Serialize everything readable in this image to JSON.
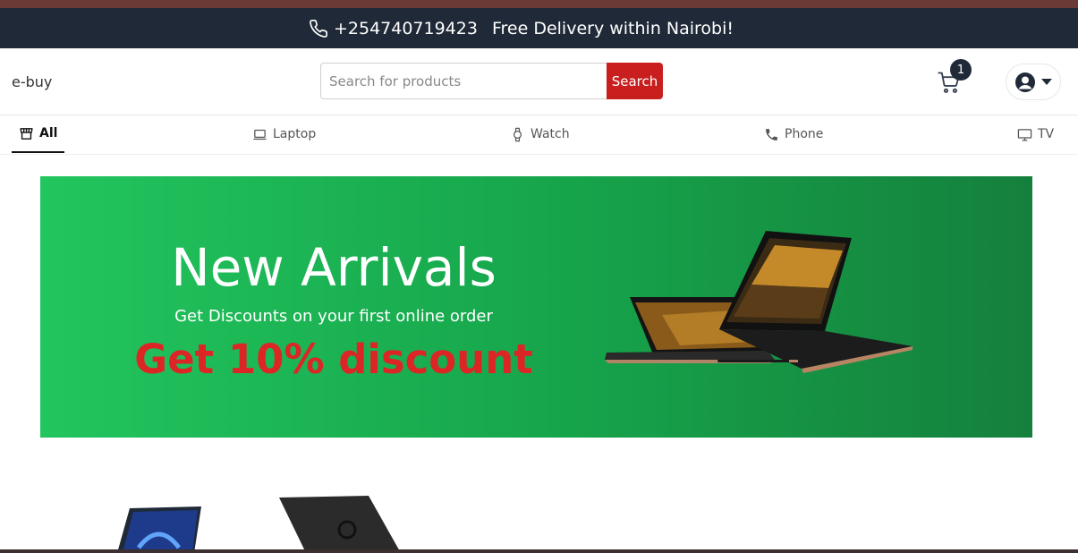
{
  "topbar": {
    "phone": "+254740719423",
    "message": "Free Delivery within Nairobi!",
    "background": "#1f2937"
  },
  "header": {
    "logo": "e-buy",
    "search": {
      "placeholder": "Search for products",
      "value": "",
      "button_label": "Search",
      "button_color": "#c81e1e"
    },
    "cart": {
      "icon": "cart-icon",
      "count": "1"
    },
    "user": {
      "icon": "user-circle-icon",
      "caret": "caret-down-icon"
    }
  },
  "nav": {
    "items": [
      {
        "label": "All",
        "icon": "store-icon",
        "active": true
      },
      {
        "label": "Laptop",
        "icon": "laptop-icon",
        "active": false
      },
      {
        "label": "Watch",
        "icon": "watch-icon",
        "active": false
      },
      {
        "label": "Phone",
        "icon": "phone-icon",
        "active": false
      },
      {
        "label": "TV",
        "icon": "tv-icon",
        "active": false
      }
    ]
  },
  "banner": {
    "title": "New Arrivals",
    "subtitle": "Get Discounts on your first online order",
    "discount": "Get 10% discount",
    "colors": {
      "start": "#22c55e",
      "end": "#15803d",
      "discount": "#dc2626"
    }
  }
}
